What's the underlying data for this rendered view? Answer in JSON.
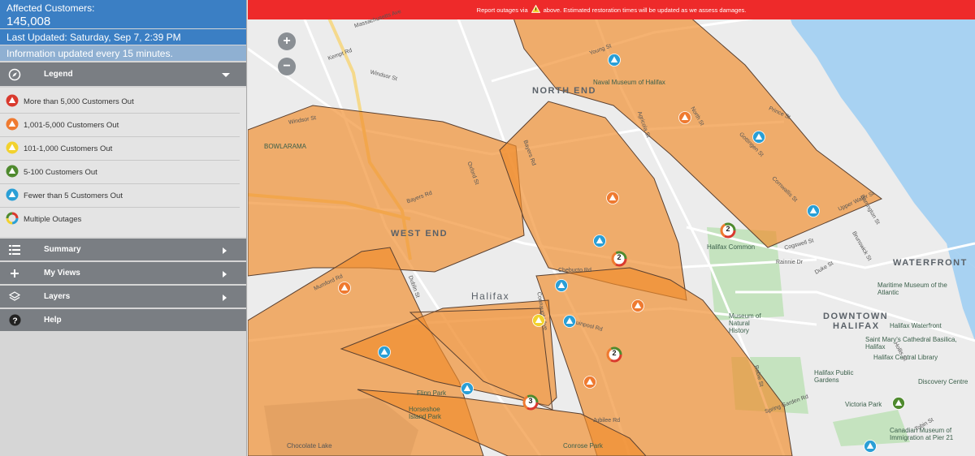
{
  "panel": {
    "affected_label": "Affected Customers:",
    "affected_count": "145,008",
    "last_updated": "Last Updated: Saturday, Sep 7, 2:39 PM",
    "interval": "Information updated every 15 minutes.",
    "legend_title": "Legend",
    "legend_items": [
      {
        "label": "More than 5,000 Customers Out",
        "color": "#d93a2e"
      },
      {
        "label": "1,001-5,000 Customers Out",
        "color": "#ef7a30"
      },
      {
        "label": "101-1,000 Customers Out",
        "color": "#f2d22e"
      },
      {
        "label": "5-100 Customers Out",
        "color": "#4f8a2e"
      },
      {
        "label": "Fewer than 5 Customers Out",
        "color": "#2a9fd6"
      },
      {
        "label": "Multiple Outages",
        "color": "multi"
      }
    ],
    "menu": [
      {
        "label": "Summary",
        "icon": "list-icon"
      },
      {
        "label": "My Views",
        "icon": "plus-icon"
      },
      {
        "label": "Layers",
        "icon": "layers-icon"
      },
      {
        "label": "Help",
        "icon": "help-icon"
      }
    ]
  },
  "map": {
    "banner_before": "Report outages via",
    "banner_after": "above. Estimated restoration times will be updated as we assess damages.",
    "zoom_in": "+",
    "zoom_out": "−",
    "areas": [
      "NORTH END",
      "WEST END",
      "Halifax",
      "WATERFRONT",
      "DOWNTOWN",
      "HALIFAX"
    ],
    "pois": [
      "BOWLARAMA",
      "Naval Museum of Halifax",
      "Halifax Common",
      "Maritime Museum of the Atlantic",
      "Museum of Natural History",
      "Saint Mary's Cathedral Basilica, Halifax",
      "Halifax Central Library",
      "Halifax Waterfront",
      "Halifax Public Gardens",
      "Victoria Park",
      "Discovery Centre",
      "Canadian Museum of Immigration at Pier 21",
      "Chocolate Lake",
      "Conrose Park",
      "Horseshoe Island Park",
      "Flinn Park"
    ],
    "streets": [
      "Massachusetts Ave",
      "Windsor St",
      "Kempt Rd",
      "Young St",
      "Agricola St",
      "Gottingen St",
      "Cornwallis St",
      "Barrington St",
      "Bayers Rd",
      "Chebucto Rd",
      "Quinpool Rd",
      "Oxford St",
      "Mumford Rd",
      "Jubilee Rd",
      "Spring Garden Rd",
      "Robie St",
      "North St",
      "Cogswell St",
      "Duke St",
      "Brunswick St",
      "Upper Water St",
      "Prince St",
      "Hollis St",
      "Tobin St",
      "Windsor St",
      "Connaught Ave",
      "Dublin St",
      "Bayers Rd",
      "Rainnie Dr"
    ],
    "multi_counts": [
      "2",
      "2",
      "2",
      "3"
    ]
  }
}
